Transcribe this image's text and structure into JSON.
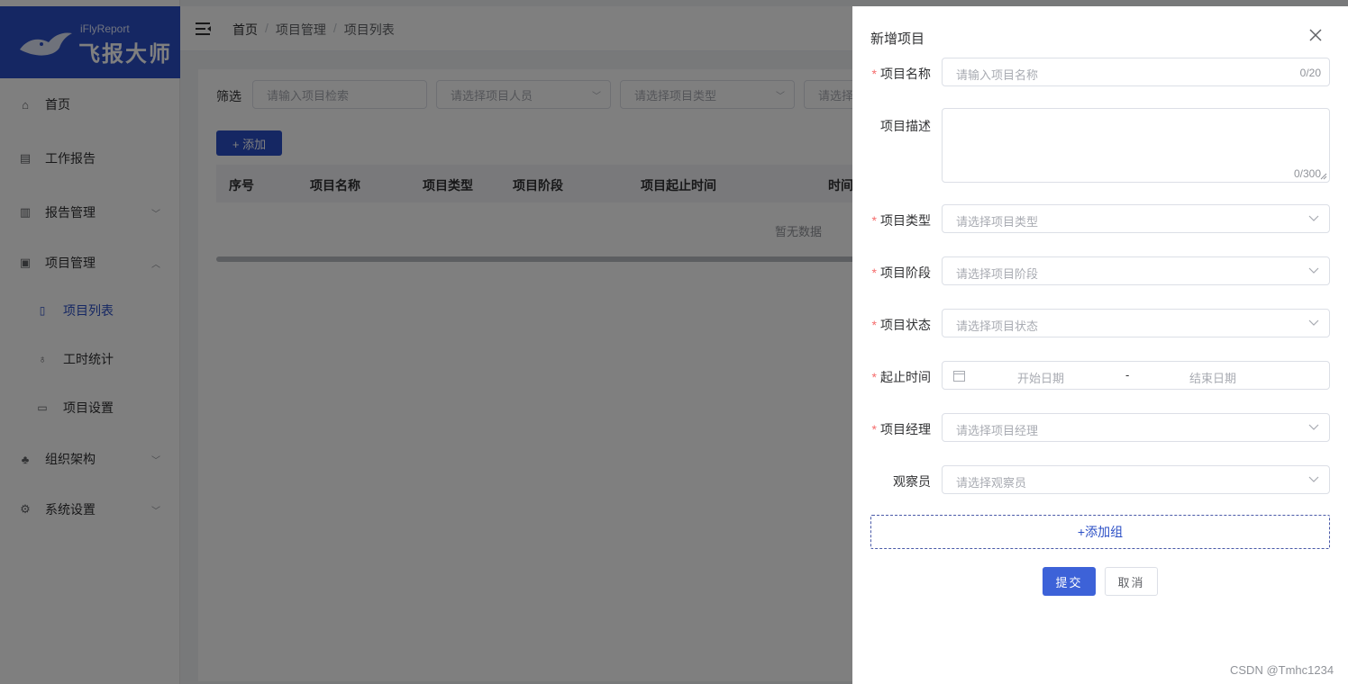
{
  "logo": {
    "sub": "iFlyReport",
    "main": "飞报大师"
  },
  "sidebar": {
    "items": [
      {
        "label": "首页",
        "icon": "home-icon"
      },
      {
        "label": "工作报告",
        "icon": "report-icon"
      },
      {
        "label": "报告管理",
        "icon": "book-icon",
        "arrow": "﹀"
      },
      {
        "label": "项目管理",
        "icon": "camera-icon",
        "arrow": "︿"
      },
      {
        "label": "组织架构",
        "icon": "org-icon",
        "arrow": "﹀"
      },
      {
        "label": "系统设置",
        "icon": "gear-icon",
        "arrow": "﹀"
      }
    ],
    "subitems": [
      {
        "label": "项目列表",
        "icon": "document-icon"
      },
      {
        "label": "工时统计",
        "icon": "stats-icon"
      },
      {
        "label": "项目设置",
        "icon": "folder-settings-icon"
      }
    ]
  },
  "breadcrumb": {
    "items": [
      "首页",
      "项目管理",
      "项目列表"
    ],
    "separator": "/"
  },
  "filters": {
    "label": "筛选",
    "search_placeholder": "请输入项目检索",
    "member_placeholder": "请选择项目人员",
    "type_placeholder": "请选择项目类型",
    "other_placeholder": "请选择"
  },
  "toolbar": {
    "add_label": "+ 添加"
  },
  "table": {
    "columns": [
      "序号",
      "项目名称",
      "项目类型",
      "项目阶段",
      "项目起止时间",
      "时间"
    ],
    "empty_text": "暂无数据"
  },
  "drawer": {
    "title": "新增项目",
    "fields": {
      "name": {
        "label": "项目名称",
        "placeholder": "请输入项目名称",
        "counter": "0/20",
        "required": true
      },
      "desc": {
        "label": "项目描述",
        "counter": "0/300",
        "required": false
      },
      "type": {
        "label": "项目类型",
        "placeholder": "请选择项目类型",
        "required": true
      },
      "stage": {
        "label": "项目阶段",
        "placeholder": "请选择项目阶段",
        "required": true
      },
      "status": {
        "label": "项目状态",
        "placeholder": "请选择项目状态",
        "required": true
      },
      "period": {
        "label": "起止时间",
        "start": "开始日期",
        "sep": "-",
        "end": "结束日期",
        "required": true
      },
      "manager": {
        "label": "项目经理",
        "placeholder": "请选择项目经理",
        "required": true
      },
      "observer": {
        "label": "观察员",
        "placeholder": "请选择观察员",
        "required": false
      }
    },
    "add_group_label": "+添加组",
    "submit_label": "提交",
    "cancel_label": "取消",
    "required_mark": "*"
  },
  "watermark": "CSDN @Tmhc1234",
  "colors": {
    "brand": "#2b4fc6",
    "required": "#f56c6c",
    "primary_button": "#3d62d8"
  }
}
